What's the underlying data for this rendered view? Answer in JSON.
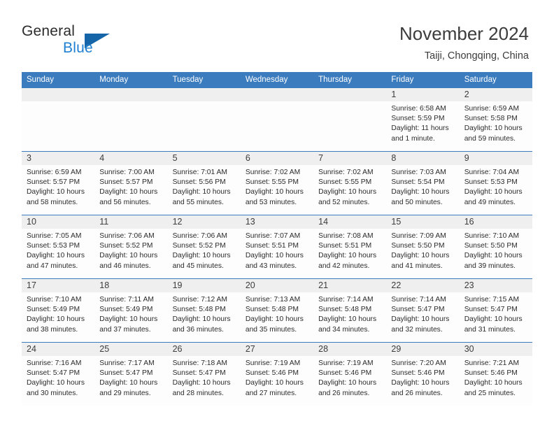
{
  "brand": {
    "name_part1": "General",
    "name_part2": "Blue",
    "triangle_color": "#1565a8",
    "blue_text_color": "#1f7fd0"
  },
  "header": {
    "title": "November 2024",
    "subtitle": "Taiji, Chongqing, China",
    "accent_color": "#3b7cbf",
    "daynum_bg": "#efefef"
  },
  "weekdays": [
    "Sunday",
    "Monday",
    "Tuesday",
    "Wednesday",
    "Thursday",
    "Friday",
    "Saturday"
  ],
  "weeks": [
    [
      {
        "empty": true
      },
      {
        "empty": true
      },
      {
        "empty": true
      },
      {
        "empty": true
      },
      {
        "empty": true
      },
      {
        "day": "1",
        "sunrise": "Sunrise: 6:58 AM",
        "sunset": "Sunset: 5:59 PM",
        "daylight": "Daylight: 11 hours and 1 minute."
      },
      {
        "day": "2",
        "sunrise": "Sunrise: 6:59 AM",
        "sunset": "Sunset: 5:58 PM",
        "daylight": "Daylight: 10 hours and 59 minutes."
      }
    ],
    [
      {
        "day": "3",
        "sunrise": "Sunrise: 6:59 AM",
        "sunset": "Sunset: 5:57 PM",
        "daylight": "Daylight: 10 hours and 58 minutes."
      },
      {
        "day": "4",
        "sunrise": "Sunrise: 7:00 AM",
        "sunset": "Sunset: 5:57 PM",
        "daylight": "Daylight: 10 hours and 56 minutes."
      },
      {
        "day": "5",
        "sunrise": "Sunrise: 7:01 AM",
        "sunset": "Sunset: 5:56 PM",
        "daylight": "Daylight: 10 hours and 55 minutes."
      },
      {
        "day": "6",
        "sunrise": "Sunrise: 7:02 AM",
        "sunset": "Sunset: 5:55 PM",
        "daylight": "Daylight: 10 hours and 53 minutes."
      },
      {
        "day": "7",
        "sunrise": "Sunrise: 7:02 AM",
        "sunset": "Sunset: 5:55 PM",
        "daylight": "Daylight: 10 hours and 52 minutes."
      },
      {
        "day": "8",
        "sunrise": "Sunrise: 7:03 AM",
        "sunset": "Sunset: 5:54 PM",
        "daylight": "Daylight: 10 hours and 50 minutes."
      },
      {
        "day": "9",
        "sunrise": "Sunrise: 7:04 AM",
        "sunset": "Sunset: 5:53 PM",
        "daylight": "Daylight: 10 hours and 49 minutes."
      }
    ],
    [
      {
        "day": "10",
        "sunrise": "Sunrise: 7:05 AM",
        "sunset": "Sunset: 5:53 PM",
        "daylight": "Daylight: 10 hours and 47 minutes."
      },
      {
        "day": "11",
        "sunrise": "Sunrise: 7:06 AM",
        "sunset": "Sunset: 5:52 PM",
        "daylight": "Daylight: 10 hours and 46 minutes."
      },
      {
        "day": "12",
        "sunrise": "Sunrise: 7:06 AM",
        "sunset": "Sunset: 5:52 PM",
        "daylight": "Daylight: 10 hours and 45 minutes."
      },
      {
        "day": "13",
        "sunrise": "Sunrise: 7:07 AM",
        "sunset": "Sunset: 5:51 PM",
        "daylight": "Daylight: 10 hours and 43 minutes."
      },
      {
        "day": "14",
        "sunrise": "Sunrise: 7:08 AM",
        "sunset": "Sunset: 5:51 PM",
        "daylight": "Daylight: 10 hours and 42 minutes."
      },
      {
        "day": "15",
        "sunrise": "Sunrise: 7:09 AM",
        "sunset": "Sunset: 5:50 PM",
        "daylight": "Daylight: 10 hours and 41 minutes."
      },
      {
        "day": "16",
        "sunrise": "Sunrise: 7:10 AM",
        "sunset": "Sunset: 5:50 PM",
        "daylight": "Daylight: 10 hours and 39 minutes."
      }
    ],
    [
      {
        "day": "17",
        "sunrise": "Sunrise: 7:10 AM",
        "sunset": "Sunset: 5:49 PM",
        "daylight": "Daylight: 10 hours and 38 minutes."
      },
      {
        "day": "18",
        "sunrise": "Sunrise: 7:11 AM",
        "sunset": "Sunset: 5:49 PM",
        "daylight": "Daylight: 10 hours and 37 minutes."
      },
      {
        "day": "19",
        "sunrise": "Sunrise: 7:12 AM",
        "sunset": "Sunset: 5:48 PM",
        "daylight": "Daylight: 10 hours and 36 minutes."
      },
      {
        "day": "20",
        "sunrise": "Sunrise: 7:13 AM",
        "sunset": "Sunset: 5:48 PM",
        "daylight": "Daylight: 10 hours and 35 minutes."
      },
      {
        "day": "21",
        "sunrise": "Sunrise: 7:14 AM",
        "sunset": "Sunset: 5:48 PM",
        "daylight": "Daylight: 10 hours and 34 minutes."
      },
      {
        "day": "22",
        "sunrise": "Sunrise: 7:14 AM",
        "sunset": "Sunset: 5:47 PM",
        "daylight": "Daylight: 10 hours and 32 minutes."
      },
      {
        "day": "23",
        "sunrise": "Sunrise: 7:15 AM",
        "sunset": "Sunset: 5:47 PM",
        "daylight": "Daylight: 10 hours and 31 minutes."
      }
    ],
    [
      {
        "day": "24",
        "sunrise": "Sunrise: 7:16 AM",
        "sunset": "Sunset: 5:47 PM",
        "daylight": "Daylight: 10 hours and 30 minutes."
      },
      {
        "day": "25",
        "sunrise": "Sunrise: 7:17 AM",
        "sunset": "Sunset: 5:47 PM",
        "daylight": "Daylight: 10 hours and 29 minutes."
      },
      {
        "day": "26",
        "sunrise": "Sunrise: 7:18 AM",
        "sunset": "Sunset: 5:47 PM",
        "daylight": "Daylight: 10 hours and 28 minutes."
      },
      {
        "day": "27",
        "sunrise": "Sunrise: 7:19 AM",
        "sunset": "Sunset: 5:46 PM",
        "daylight": "Daylight: 10 hours and 27 minutes."
      },
      {
        "day": "28",
        "sunrise": "Sunrise: 7:19 AM",
        "sunset": "Sunset: 5:46 PM",
        "daylight": "Daylight: 10 hours and 26 minutes."
      },
      {
        "day": "29",
        "sunrise": "Sunrise: 7:20 AM",
        "sunset": "Sunset: 5:46 PM",
        "daylight": "Daylight: 10 hours and 26 minutes."
      },
      {
        "day": "30",
        "sunrise": "Sunrise: 7:21 AM",
        "sunset": "Sunset: 5:46 PM",
        "daylight": "Daylight: 10 hours and 25 minutes."
      }
    ]
  ]
}
